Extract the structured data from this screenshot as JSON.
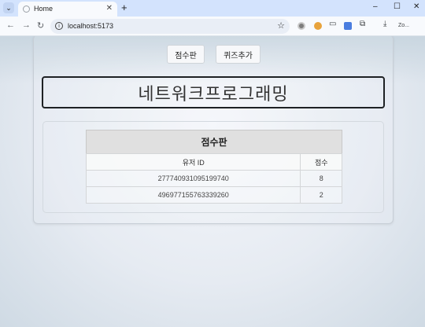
{
  "browser": {
    "tab_title": "Home",
    "url": "localhost:5173",
    "new_tab": "+",
    "window_controls": {
      "minimize": "–",
      "maximize": "☐",
      "close": "✕"
    },
    "extension_label": "Zo..."
  },
  "app": {
    "buttons": {
      "scoreboard": "점수판",
      "add_quiz": "퀴즈추가"
    },
    "title": "네트워크프로그래밍",
    "scoreboard": {
      "caption": "점수판",
      "columns": [
        "유저 ID",
        "점수"
      ],
      "rows": [
        {
          "user_id": "277740931095199740",
          "score": "8"
        },
        {
          "user_id": "496977155763339260",
          "score": "2"
        }
      ]
    }
  },
  "icons": {
    "tab_search": "chevron-down-icon",
    "favicon": "globe-icon",
    "back": "arrow-left-icon",
    "forward": "arrow-right-icon",
    "reload": "reload-icon",
    "site_info": "info-icon",
    "bookmark": "star-icon",
    "download": "download-icon"
  },
  "colors": {
    "tabbar": "#d3e3fd",
    "title_border": "#1e2124",
    "table_header": "#e0e0e0"
  }
}
